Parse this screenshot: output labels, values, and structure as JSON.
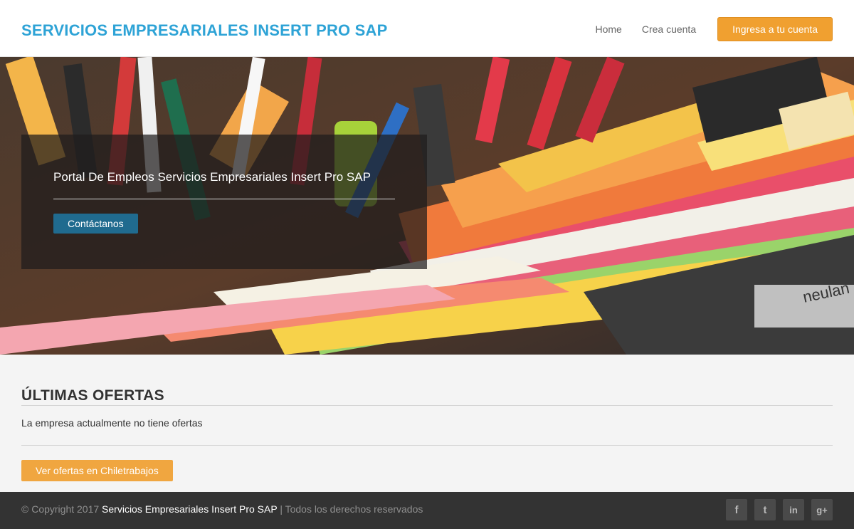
{
  "header": {
    "brand": "SERVICIOS EMPRESARIALES INSERT PRO SAP",
    "nav": {
      "home": "Home",
      "create_account": "Crea cuenta",
      "login": "Ingresa a tu cuenta"
    }
  },
  "hero": {
    "title": "Portal De Empleos Servicios Empresariales Insert Pro SAP",
    "contact_button": "Contáctanos"
  },
  "offers": {
    "title": "ÚLTIMAS OFERTAS",
    "empty_message": "La empresa actualmente no tiene ofertas",
    "button": "Ver ofertas en Chiletrabajos"
  },
  "footer": {
    "copyright_prefix": "© Copyright 2017 ",
    "company": "Servicios Empresariales Insert Pro SAP",
    "copyright_suffix": " | Todos los derechos reservados",
    "social": [
      {
        "icon": "facebook-icon",
        "glyph": "f"
      },
      {
        "icon": "twitter-icon",
        "glyph": "t"
      },
      {
        "icon": "linkedin-icon",
        "glyph": "in"
      },
      {
        "icon": "google-plus-icon",
        "glyph": "g+"
      }
    ]
  },
  "colors": {
    "brand": "#2ea3d6",
    "accent_orange": "#f0a030",
    "hero_button": "#206b8f",
    "footer_bg": "#333333"
  }
}
